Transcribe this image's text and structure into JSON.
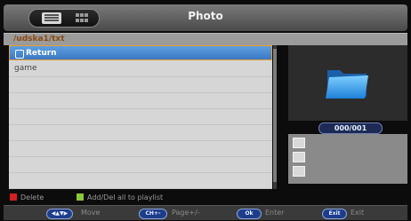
{
  "header": {
    "title": "Photo",
    "view_modes": [
      "list-view",
      "thumbnail-view"
    ],
    "active_view": "list-view"
  },
  "path": "/udska1/txt",
  "list": {
    "items": [
      {
        "label": "Return",
        "icon": "return-icon",
        "selected": true
      },
      {
        "label": "game",
        "icon": "",
        "selected": false
      }
    ]
  },
  "preview": {
    "icon": "folder-icon",
    "counter": "000/001"
  },
  "hints": {
    "delete": "Delete",
    "add_playlist": "Add/Del all to playlist",
    "delete_color": "#d42020",
    "add_color": "#8ac83a"
  },
  "buttons": [
    {
      "key": "◀▲▼▶",
      "label": "Move"
    },
    {
      "key": "CH+-",
      "label": "Page+/-"
    },
    {
      "key": "Ok",
      "label": "Enter"
    },
    {
      "key": "Exit",
      "label": "Exit"
    }
  ],
  "colors": {
    "selection": "#4a8ad4",
    "selection_border": "#e8a030",
    "counter_bg": "#1c2a55"
  }
}
